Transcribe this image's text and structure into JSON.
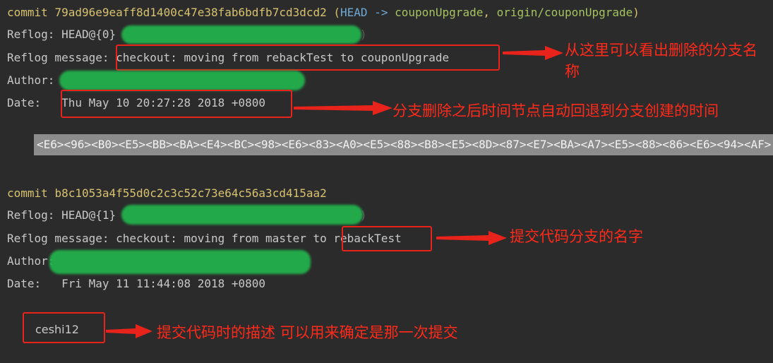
{
  "commit1": {
    "label": "commit",
    "hash": "79ad96e9eaff8d1400c47e38fab6bdfb7cd3dcd2",
    "refs_open": "(",
    "head": "HEAD",
    "arrow": "->",
    "branch": "couponUpgrade",
    "sep": ", ",
    "origin": "origin/couponUpgrade",
    "refs_close": ")",
    "reflog_label": "Reflog: ",
    "reflog_value": "HEAD@{0}",
    "reflog_tail": ")",
    "message_label": "Reflog message: ",
    "message_value": "checkout: moving from rebackTest to couponUpgrade",
    "author_label": "Author:",
    "date_label": "Date:",
    "date_value": "Thu May 10 20:27:28 2018 +0800",
    "encoded_body": "<E6><96><B0><E5><BB><BA><E4><BC><98><E6><83><A0><E5><88><B8><E5><8D><87><E7><BA><A7><E5><88><86><E6><94><AF>"
  },
  "commit2": {
    "label": "commit",
    "hash": "b8c1053a4f55d0c2c3c52c73e64c56a3cd415aa2",
    "reflog_label": "Reflog: ",
    "reflog_value": "HEAD@{1}",
    "reflog_tail": ")",
    "message_label": "Reflog message: ",
    "message_prefix": "checkout: moving from master to ",
    "message_value": "rebackTest",
    "author_label": "Author:",
    "date_label": "Date:",
    "date_value": "Fri May 11 11:44:08 2018 +0800",
    "body": "ceshi12"
  },
  "annotations": {
    "deleted_branch": "从这里可以看出删除的分支名称",
    "time_rollback": "分支删除之后时间节点自动回退到分支创建的时间",
    "branch_name": "提交代码分支的名字",
    "commit_desc": "提交代码时的描述 可以用来确定是那一次提交"
  },
  "colors": {
    "annotation": "#ff2a1a",
    "hash": "#d7c26f",
    "head": "#6ea9d6",
    "branch": "#a5c261",
    "redaction": "#22b14c"
  }
}
